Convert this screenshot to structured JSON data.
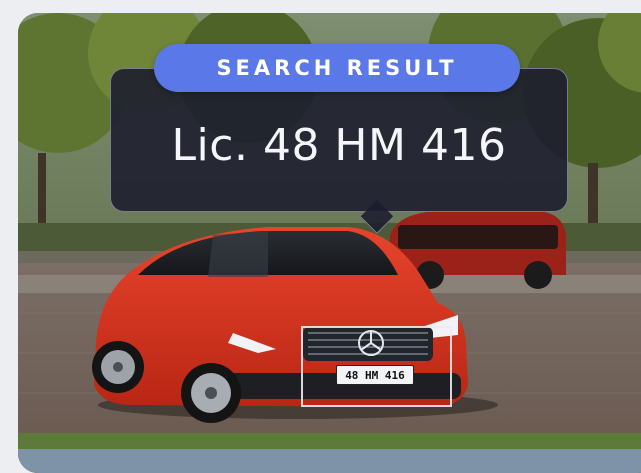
{
  "detection": {
    "label": "SEARCH RESULT",
    "plate_text": "Lic. 48 HM 416",
    "plate_on_car": "48 HM 416",
    "accent_color": "#5b78e8"
  },
  "scene": {
    "car_color": "#d8321f",
    "car_brand_logo": "mercedes-star-icon"
  }
}
